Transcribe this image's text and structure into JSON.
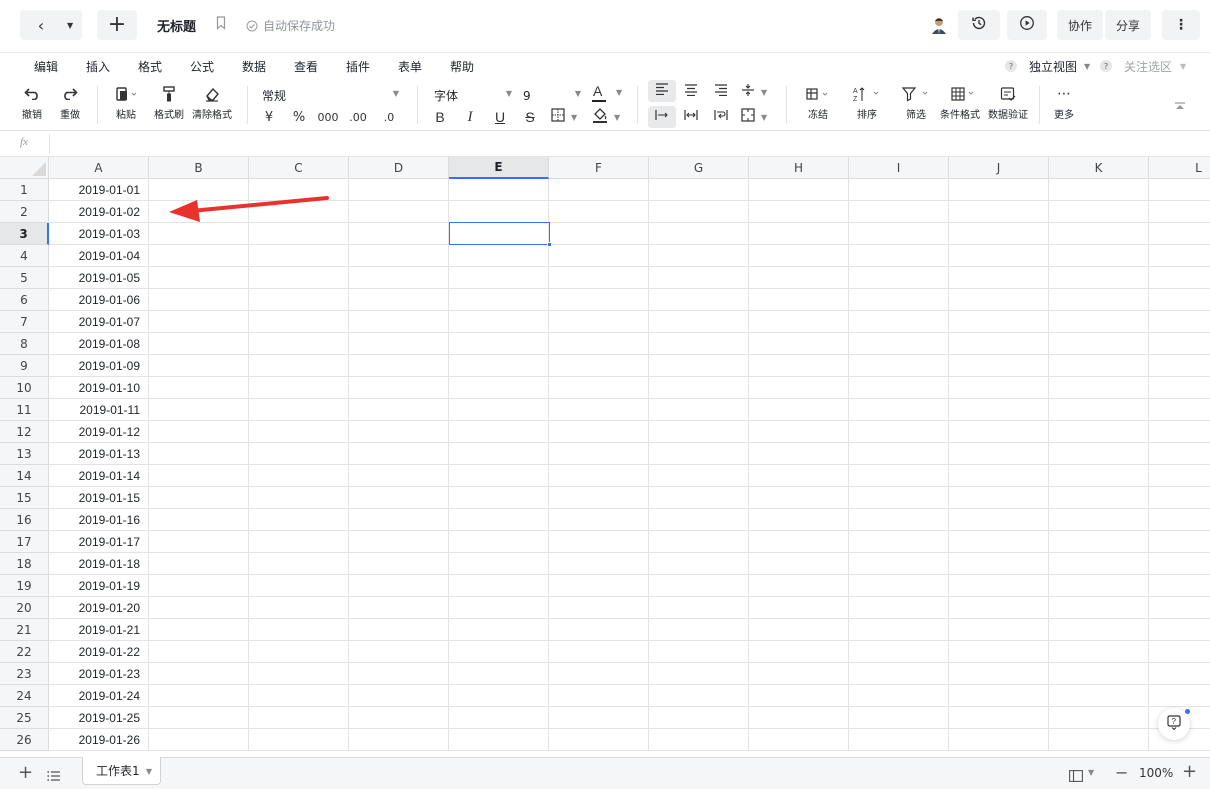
{
  "top": {
    "title": "无标题",
    "autosave": "自动保存成功",
    "collab": "协作",
    "share": "分享"
  },
  "menu": [
    "编辑",
    "插入",
    "格式",
    "公式",
    "数据",
    "查看",
    "插件",
    "表单",
    "帮助"
  ],
  "menu_right": {
    "independent_view": "独立视图",
    "focus_selection": "关注选区"
  },
  "toolbar": {
    "undo": "撤销",
    "redo": "重做",
    "paste": "粘贴",
    "format_painter": "格式刷",
    "clear_format": "清除格式",
    "number_format": "常规",
    "currency": "¥",
    "percent": "%",
    "thousands": "000",
    "dec_inc": ".00",
    "dec_dec": ".0",
    "font": "字体",
    "font_size": "9",
    "bold": "B",
    "italic": "I",
    "underline": "U",
    "strike": "S",
    "freeze": "冻结",
    "sort": "排序",
    "filter": "筛选",
    "cond_format": "条件格式",
    "data_validation": "数据验证",
    "more": "更多"
  },
  "fx": {
    "label": "fx",
    "value": ""
  },
  "grid": {
    "columns": [
      "A",
      "B",
      "C",
      "D",
      "E",
      "F",
      "G",
      "H",
      "I",
      "J",
      "K",
      "L"
    ],
    "active_column": "E",
    "active_row": "3",
    "rows": [
      {
        "num": "1",
        "a": "2019-01-01"
      },
      {
        "num": "2",
        "a": "2019-01-02"
      },
      {
        "num": "3",
        "a": "2019-01-03"
      },
      {
        "num": "4",
        "a": "2019-01-04"
      },
      {
        "num": "5",
        "a": "2019-01-05"
      },
      {
        "num": "6",
        "a": "2019-01-06"
      },
      {
        "num": "7",
        "a": "2019-01-07"
      },
      {
        "num": "8",
        "a": "2019-01-08"
      },
      {
        "num": "9",
        "a": "2019-01-09"
      },
      {
        "num": "10",
        "a": "2019-01-10"
      },
      {
        "num": "11",
        "a": "2019-01-11"
      },
      {
        "num": "12",
        "a": "2019-01-12"
      },
      {
        "num": "13",
        "a": "2019-01-13"
      },
      {
        "num": "14",
        "a": "2019-01-14"
      },
      {
        "num": "15",
        "a": "2019-01-15"
      },
      {
        "num": "16",
        "a": "2019-01-16"
      },
      {
        "num": "17",
        "a": "2019-01-17"
      },
      {
        "num": "18",
        "a": "2019-01-18"
      },
      {
        "num": "19",
        "a": "2019-01-19"
      },
      {
        "num": "20",
        "a": "2019-01-20"
      },
      {
        "num": "21",
        "a": "2019-01-21"
      },
      {
        "num": "22",
        "a": "2019-01-22"
      },
      {
        "num": "23",
        "a": "2019-01-23"
      },
      {
        "num": "24",
        "a": "2019-01-24"
      },
      {
        "num": "25",
        "a": "2019-01-25"
      },
      {
        "num": "26",
        "a": "2019-01-26"
      }
    ]
  },
  "bottom": {
    "sheet_tab": "工作表1",
    "zoom": "100%"
  },
  "colors": {
    "accent": "#3370ff",
    "annotation_arrow": "#e8322b"
  }
}
